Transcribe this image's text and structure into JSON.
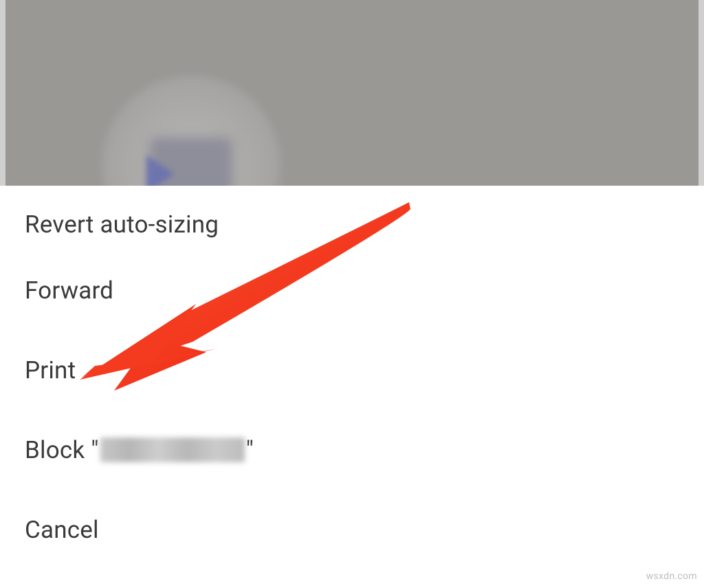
{
  "menu": {
    "items": [
      {
        "label": "Revert auto-sizing"
      },
      {
        "label": "Forward"
      },
      {
        "label": "Print"
      },
      {
        "prefix": "Block \"",
        "suffix": "\""
      },
      {
        "label": "Cancel"
      }
    ]
  },
  "annotation": {
    "arrow_color": "#f43a1f"
  },
  "watermark": "wsxdn.com"
}
